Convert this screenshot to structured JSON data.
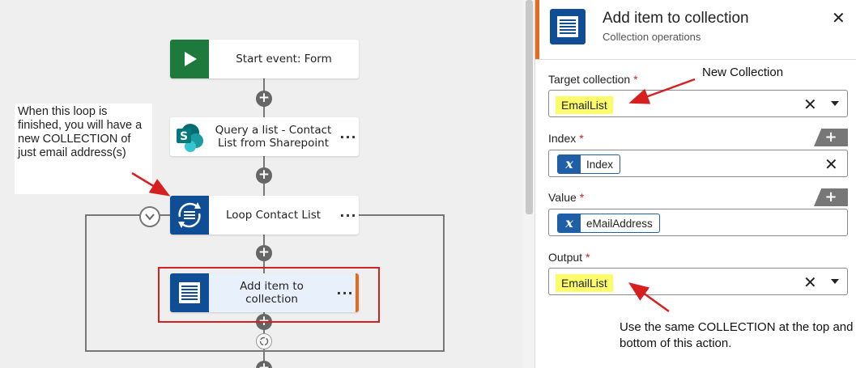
{
  "workflow": {
    "start_card": {
      "label": "Start event: Form"
    },
    "query_card": {
      "label": "Query a list - Contact List from Sharepoint",
      "more": "···"
    },
    "loop_card": {
      "label": "Loop Contact List",
      "more": "···"
    },
    "add_card": {
      "label": "Add item to collection",
      "more": "···"
    },
    "note": "When this loop is finished, you will have a new COLLECTION of just email address(s)"
  },
  "panel": {
    "title": "Add item to collection",
    "subtitle": "Collection operations",
    "close": "✕",
    "fields": {
      "target_label": "Target collection",
      "target_value": "EmailList",
      "index_label": "Index",
      "index_var": "Index",
      "value_label": "Value",
      "value_var": "eMailAddress",
      "output_label": "Output",
      "output_value": "EmailList",
      "required_mark": "*",
      "var_glyph": "x",
      "clear": "✕",
      "add": "+"
    },
    "annotations": {
      "new_collection": "New Collection",
      "same_collection": "Use the same COLLECTION at the top and bottom of this action."
    }
  },
  "colors": {
    "accent_orange": "#e66a1e",
    "action_blue": "#0f4e95",
    "start_green": "#1e7a3c",
    "highlight_yellow": "#fcfc6a",
    "annotation_red": "#d62020"
  },
  "icons": [
    "play-icon",
    "sharepoint-icon",
    "loop-icon",
    "collection-list-icon",
    "chevron-down-icon",
    "close-icon",
    "variable-icon",
    "plus-icon"
  ]
}
